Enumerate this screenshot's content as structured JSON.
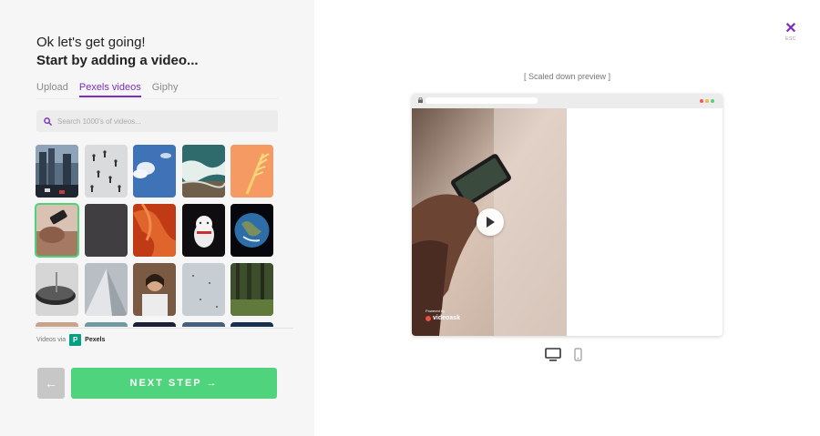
{
  "left": {
    "heading_line1": "Ok let's get going!",
    "heading_line2": "Start by adding a video...",
    "tabs": [
      {
        "label": "Upload",
        "active": false
      },
      {
        "label": "Pexels videos",
        "active": true
      },
      {
        "label": "Giphy",
        "active": false
      }
    ],
    "search": {
      "placeholder": "Search 1000's of videos..."
    },
    "credit": {
      "prefix": "Videos via",
      "logo_letter": "P",
      "provider": "Pexels"
    },
    "back_label": "←",
    "next_label": "NEXT STEP →"
  },
  "close": {
    "icon": "close-icon",
    "label": "ESC"
  },
  "preview": {
    "label": "[ Scaled down preview ]",
    "powered_by": "Powered by",
    "brand": "videoask"
  },
  "devices": [
    {
      "icon": "desktop-icon",
      "active": true
    },
    {
      "icon": "mobile-icon",
      "active": false
    }
  ],
  "colors": {
    "accent": "#7b2cbf",
    "cta": "#4fd37c",
    "panel_bg": "#f6f6f6"
  }
}
